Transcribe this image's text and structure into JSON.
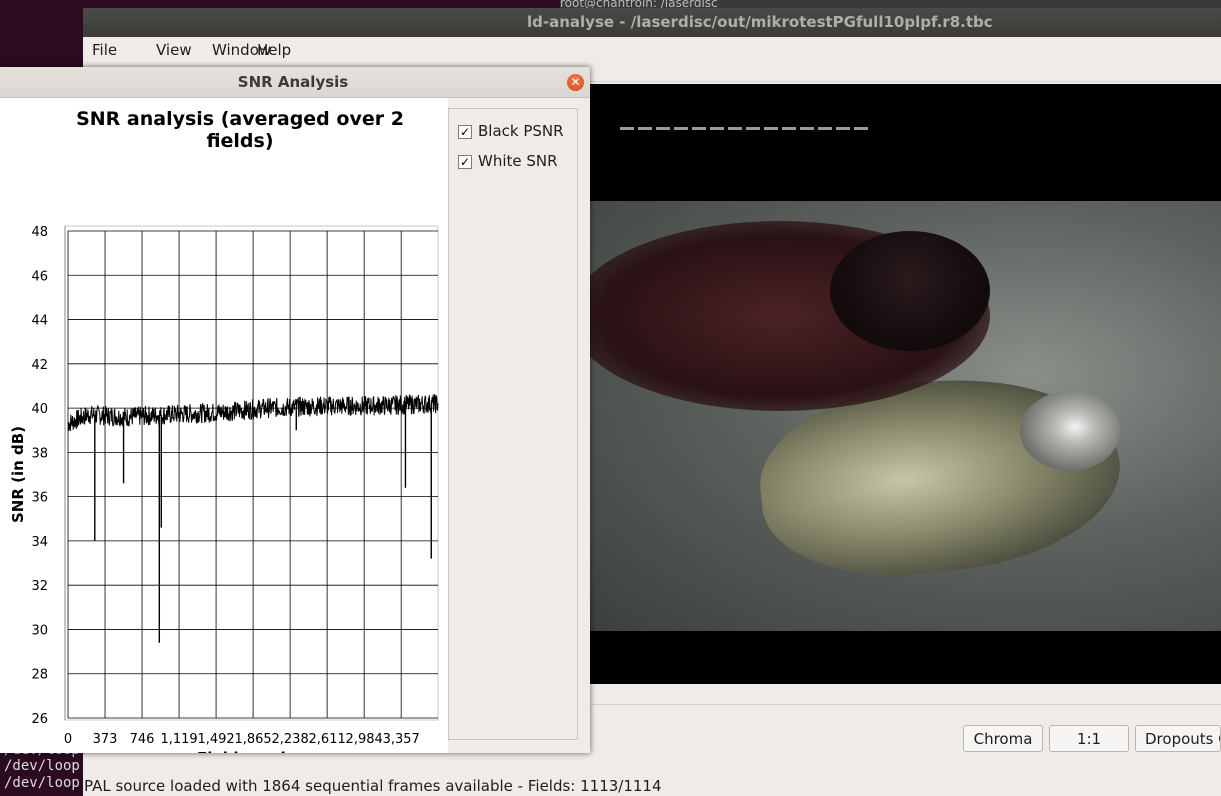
{
  "terminal": {
    "title": "root@chantroin: /laserdisc",
    "lines": [
      "/dev/loop",
      "/dev/loop",
      "/dev/loop"
    ]
  },
  "main_window": {
    "title": "ld-analyse - /laserdisc/out/mikrotestPGfull10plpf.r8.tbc",
    "menu": {
      "file": "File",
      "view": "View",
      "window": "Window",
      "help": "Help"
    },
    "buttons": {
      "chroma": "Chroma",
      "zoom": "1:1",
      "dropouts": "Dropouts C"
    },
    "status": "PAL source loaded with 1864 sequential frames available  -  Fields: 1113/1114"
  },
  "snr_dialog": {
    "title": "SNR Analysis",
    "close_icon": "close-icon",
    "legend": {
      "black_psnr": {
        "label": "Black PSNR",
        "checked": true
      },
      "white_snr": {
        "label": "White SNR",
        "checked": true
      }
    }
  },
  "chart_data": {
    "type": "line",
    "title_lines": [
      "SNR analysis (averaged over 2",
      "fields)"
    ],
    "xlabel": "Field number",
    "ylabel": "SNR (in dB)",
    "xlim": [
      0,
      3728
    ],
    "ylim": [
      26,
      48
    ],
    "x_ticks": [
      "0",
      "373",
      "746",
      "1,119",
      "1,492",
      "1,865",
      "2,238",
      "2,611",
      "2,984",
      "3,357"
    ],
    "y_ticks": [
      26,
      28,
      30,
      32,
      34,
      36,
      38,
      40,
      42,
      44,
      46,
      48
    ],
    "grid": true,
    "series": [
      {
        "name": "White SNR",
        "color": "#000000",
        "baseline": [
          [
            0,
            39.3
          ],
          [
            200,
            39.7
          ],
          [
            600,
            39.6
          ],
          [
            1000,
            39.7
          ],
          [
            1500,
            39.8
          ],
          [
            2000,
            40.0
          ],
          [
            2600,
            40.1
          ],
          [
            3000,
            40.1
          ],
          [
            3700,
            40.2
          ]
        ],
        "dips": [
          [
            270,
            34.0
          ],
          [
            560,
            36.6
          ],
          [
            920,
            29.4
          ],
          [
            940,
            34.6
          ],
          [
            2300,
            39.0
          ],
          [
            3400,
            36.4
          ],
          [
            3660,
            33.2
          ]
        ]
      }
    ],
    "colors": {
      "plot_bg": "#ffffff",
      "grid": "#000000",
      "line": "#000000"
    }
  }
}
